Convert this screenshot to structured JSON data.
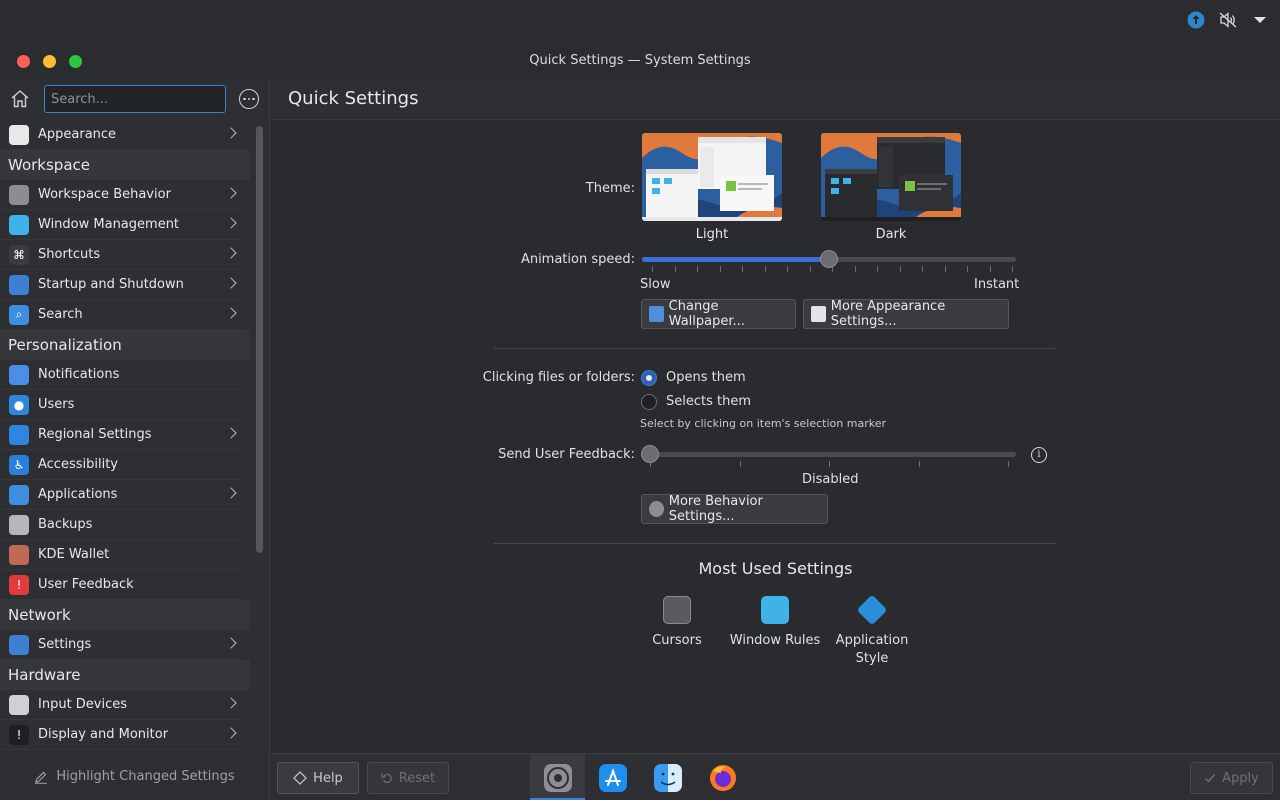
{
  "window_title": "Quick Settings — System Settings",
  "tray": {
    "icons": [
      "updates-icon",
      "muted-speaker-icon",
      "dropdown-icon"
    ]
  },
  "sidebar": {
    "search_placeholder": "Search...",
    "items": [
      {
        "type": "item",
        "label": "Appearance",
        "icon": "appearance-icon",
        "color": "#e8e8e8",
        "chevron": true
      },
      {
        "type": "category",
        "label": "Workspace"
      },
      {
        "type": "item",
        "label": "Workspace Behavior",
        "icon": "workspace-behavior-icon",
        "color": "#8c8d91",
        "chevron": true
      },
      {
        "type": "item",
        "label": "Window Management",
        "icon": "window-management-icon",
        "color": "#3fb2e8",
        "chevron": true
      },
      {
        "type": "item",
        "label": "Shortcuts",
        "icon": "shortcuts-icon",
        "color": "#3a3b3f",
        "chevron": true
      },
      {
        "type": "item",
        "label": "Startup and Shutdown",
        "icon": "startup-icon",
        "color": "#3d7fd0",
        "chevron": true
      },
      {
        "type": "item",
        "label": "Search",
        "icon": "search-icon",
        "color": "#3d8de0",
        "chevron": true
      },
      {
        "type": "category",
        "label": "Personalization"
      },
      {
        "type": "item",
        "label": "Notifications",
        "icon": "notifications-icon",
        "color": "#4a8ee8",
        "chevron": false
      },
      {
        "type": "item",
        "label": "Users",
        "icon": "users-icon",
        "color": "#2e86de",
        "chevron": false
      },
      {
        "type": "item",
        "label": "Regional Settings",
        "icon": "regional-settings-icon",
        "color": "#2e86de",
        "chevron": true
      },
      {
        "type": "item",
        "label": "Accessibility",
        "icon": "accessibility-icon",
        "color": "#2a7fd8",
        "chevron": false
      },
      {
        "type": "item",
        "label": "Applications",
        "icon": "applications-icon",
        "color": "#3d8de0",
        "chevron": true
      },
      {
        "type": "item",
        "label": "Backups",
        "icon": "backups-icon",
        "color": "#b5b6b9",
        "chevron": false
      },
      {
        "type": "item",
        "label": "KDE Wallet",
        "icon": "kde-wallet-icon",
        "color": "#c06a55",
        "chevron": false
      },
      {
        "type": "item",
        "label": "User Feedback",
        "icon": "user-feedback-icon",
        "color": "#e33b3b",
        "chevron": false
      },
      {
        "type": "category",
        "label": "Network"
      },
      {
        "type": "item",
        "label": "Settings",
        "icon": "network-settings-icon",
        "color": "#3d7fd0",
        "chevron": true
      },
      {
        "type": "category",
        "label": "Hardware"
      },
      {
        "type": "item",
        "label": "Input Devices",
        "icon": "input-devices-icon",
        "color": "#cfd0d3",
        "chevron": true
      },
      {
        "type": "item",
        "label": "Display and Monitor",
        "icon": "display-monitor-icon",
        "color": "#1f2024",
        "chevron": true
      }
    ],
    "highlight_label": "Highlight Changed Settings"
  },
  "main": {
    "title": "Quick Settings",
    "theme_label": "Theme:",
    "theme_light": "Light",
    "theme_dark": "Dark",
    "animation_label": "Animation speed:",
    "animation_value": 0.5,
    "slow": "Slow",
    "instant": "Instant",
    "change_wallpaper": "Change Wallpaper...",
    "more_appearance": "More Appearance Settings...",
    "clicking_label": "Clicking files or folders:",
    "opens_them": "Opens them",
    "selects_them": "Selects them",
    "selects_hint": "Select by clicking on item's selection marker",
    "feedback_label": "Send User Feedback:",
    "feedback_value": "Disabled",
    "more_behavior": "More Behavior Settings...",
    "most_used_title": "Most Used Settings",
    "most_used": [
      {
        "label": "Cursors",
        "icon": "cursors-icon"
      },
      {
        "label": "Window Rules",
        "icon": "window-rules-icon"
      },
      {
        "label": "Application Style",
        "icon": "application-style-icon"
      }
    ]
  },
  "bottom": {
    "help": "Help",
    "reset": "Reset",
    "apply": "Apply",
    "dock": [
      "system-settings-icon",
      "app-store-icon",
      "finder-icon",
      "firefox-icon"
    ]
  }
}
